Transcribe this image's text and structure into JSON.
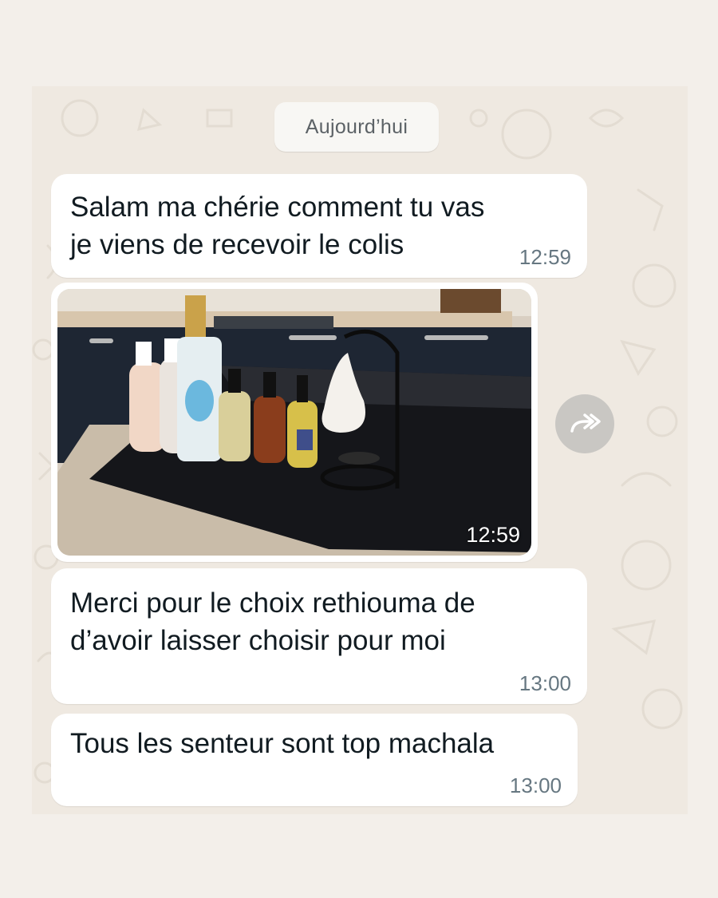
{
  "date_separator": "Aujourd’hui",
  "messages": [
    {
      "type": "text",
      "text": "Salam ma chérie comment tu vas\nje viens de recevoir le colis",
      "time": "12:59"
    },
    {
      "type": "image",
      "alt": "Photo",
      "time": "12:59",
      "forward_icon": "forward-arrows-icon"
    },
    {
      "type": "text",
      "text": "Merci pour le choix rethiouma de\nd’avoir laisser choisir pour moi",
      "time": "13:00"
    },
    {
      "type": "text",
      "text": "Tous les senteur sont top machala",
      "time": "13:00"
    }
  ],
  "colors": {
    "page_background": "#f3efea",
    "chat_background": "#efe9e1",
    "bubble": "#ffffff",
    "timestamp": "#667781"
  }
}
